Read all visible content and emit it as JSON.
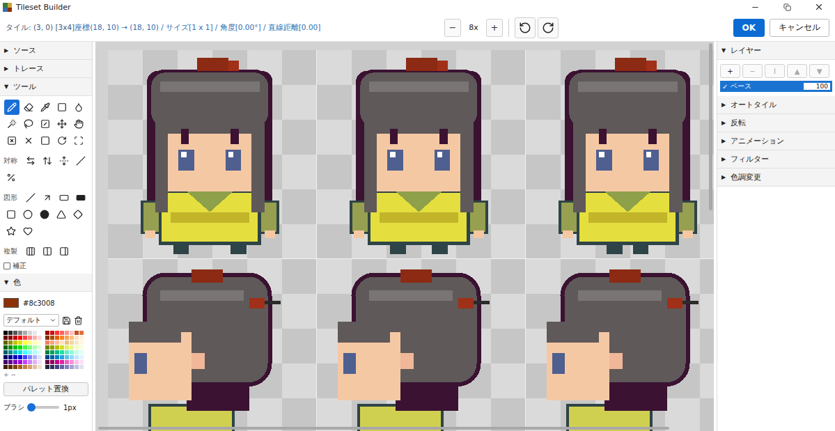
{
  "window": {
    "title": "Tileset Builder"
  },
  "status": {
    "tile": "タイル: (3, 0) [3x4]",
    "coords": "座標(18, 10) → (18, 10) / サイズ[1 x 1] / 角度[0.00°] / 直線距離[0.00]"
  },
  "zoom": {
    "decrease": "−",
    "value": "8x",
    "increase": "+"
  },
  "actions": [
    {
      "label": "OK",
      "primary": true
    },
    {
      "label": "キャンセル",
      "primary": false
    }
  ],
  "left_panel": {
    "collapsed_sections": [
      {
        "arrow": "▶",
        "label": "ソース",
        "expanded": false
      },
      {
        "arrow": "▶",
        "label": "トレース",
        "expanded": false
      }
    ],
    "tools_section": {
      "arrow": "▼",
      "label": "ツール",
      "expanded": true
    },
    "tools": [
      {
        "selected": true
      },
      {
        "selected": false
      },
      {
        "selected": false
      },
      {
        "selected": false
      },
      {
        "selected": false
      },
      {
        "selected": false
      },
      {
        "selected": false
      },
      {
        "selected": false
      },
      {
        "selected": false
      },
      {
        "selected": false
      },
      {
        "selected": false
      },
      {
        "selected": false
      },
      {
        "selected": false
      },
      {
        "selected": false
      },
      {
        "selected": false
      }
    ],
    "symmetry": {
      "label": "対称",
      "options": [
        {
          "selected": false
        },
        {
          "selected": false
        },
        {
          "selected": false
        },
        {
          "selected": false
        },
        {
          "selected": false
        }
      ]
    },
    "shapes": {
      "label": "図形",
      "options": [
        {
          "selected": false
        },
        {
          "selected": false
        },
        {
          "selected": false
        },
        {
          "selected": false
        },
        {
          "selected": false
        },
        {
          "selected": false
        },
        {
          "selected": false
        },
        {
          "selected": false
        },
        {
          "selected": false
        },
        {
          "selected": false
        },
        {
          "selected": false
        }
      ]
    },
    "duplicate": {
      "label": "複製",
      "options": [
        {
          "selected": false
        },
        {
          "selected": false
        },
        {
          "selected": false
        }
      ]
    },
    "correction": {
      "label": "補正",
      "checked": false
    },
    "color_section": {
      "arrow": "▼",
      "label": "色",
      "expanded": true
    },
    "current_color": {
      "hex": "#8c3008",
      "color": "#8c3008"
    },
    "palette_select": "デフォルト",
    "palette": [
      [
        "#000000",
        "#2b2b2b",
        "#555555",
        "#808080",
        "#aaaaaa",
        "#d4d4d4",
        "#e8e8e8",
        "#ffffff",
        "#a00000",
        "#d01010",
        "#ff3030",
        "#ff6060",
        "#ff9090",
        "#ffc0c0",
        "#c05020",
        "#e07040"
      ],
      [
        "#600000",
        "#900000",
        "#c00000",
        "#ff0000",
        "#ff4040",
        "#ff8080",
        "#ffb0b0",
        "#ffd8d8",
        "#803000",
        "#b04800",
        "#e06000",
        "#ff8020",
        "#ffa050",
        "#ffc080",
        "#ffe0c0",
        "#fff0e0"
      ],
      [
        "#606000",
        "#909000",
        "#c0c000",
        "#e0e000",
        "#ffff40",
        "#ffff80",
        "#ffffb0",
        "#ffffe0",
        "#f08060",
        "#f8a080",
        "#ffc0a0",
        "#ffe0c0",
        "#e8c080",
        "#f0d8a0",
        "#f8e8c0",
        "#fff8e0"
      ],
      [
        "#006000",
        "#009000",
        "#00c000",
        "#00e000",
        "#40ff40",
        "#80ff80",
        "#b0ffb0",
        "#e0ffe0",
        "#708000",
        "#90a000",
        "#b0c000",
        "#d0e020",
        "#e0f060",
        "#e8f890",
        "#f0ffc0",
        "#f8ffe0"
      ],
      [
        "#006060",
        "#009090",
        "#00c0c0",
        "#00e0e0",
        "#40ffff",
        "#80ffff",
        "#b0ffff",
        "#e0ffff",
        "#008040",
        "#00a060",
        "#00c080",
        "#20e0a0",
        "#60f0c0",
        "#90f8d8",
        "#c0ffe8",
        "#e0fff4"
      ],
      [
        "#000060",
        "#000090",
        "#0000c0",
        "#0000e0",
        "#4040ff",
        "#8080ff",
        "#b0b0ff",
        "#e0e0ff",
        "#004080",
        "#0060a0",
        "#0080c0",
        "#20a0e0",
        "#60c0f0",
        "#90d8f8",
        "#c0e8ff",
        "#e0f4ff"
      ],
      [
        "#400060",
        "#600090",
        "#8000c0",
        "#a000e0",
        "#c040ff",
        "#d080ff",
        "#e0b0ff",
        "#f0e0ff",
        "#600040",
        "#900060",
        "#c00080",
        "#e020a0",
        "#f060c0",
        "#f890d8",
        "#ffc0e8",
        "#ffe0f4"
      ],
      [
        "#402000",
        "#603000",
        "#804000",
        "#a06020",
        "#c08040",
        "#d0a070",
        "#e0c0a0",
        "#f0e0d0",
        "#202040",
        "#303060",
        "#404080",
        "#6060a0",
        "#8080c0",
        "#a0a0d0",
        "#c0c0e0",
        "#e0e0f0"
      ]
    ],
    "palette_controls": [
      "+",
      "−"
    ],
    "replace_button": "パレット置換",
    "brush": {
      "label": "ブラシ",
      "level": 0,
      "reading": "1px"
    }
  },
  "canvas": {
    "tiles": [
      {
        "kind": "front",
        "frame": 0
      },
      {
        "kind": "front",
        "frame": 1
      },
      {
        "kind": "front",
        "frame": 2
      },
      {
        "kind": "side",
        "frame": 0
      },
      {
        "kind": "side",
        "frame": 1
      },
      {
        "kind": "side",
        "frame": 2
      }
    ]
  },
  "right_panel": {
    "layers_section": {
      "arrow": "▼",
      "label": "レイヤー",
      "expanded": true
    },
    "layer_buttons": [
      {
        "label": "+",
        "disabled": false
      },
      {
        "label": "−",
        "disabled": true
      },
      {
        "label": "I",
        "disabled": true
      },
      {
        "label": "▲",
        "disabled": true
      },
      {
        "label": "▼",
        "disabled": true
      }
    ],
    "layers": [
      {
        "check": "✓",
        "name": "ベース",
        "opacity": "100",
        "visible": true,
        "selected": true
      }
    ],
    "sections": [
      {
        "arrow": "▶",
        "label": "オートタイル",
        "expanded": false
      },
      {
        "arrow": "▶",
        "label": "反転",
        "expanded": false
      },
      {
        "arrow": "▶",
        "label": "アニメーション",
        "expanded": false
      },
      {
        "arrow": "▶",
        "label": "フィルター",
        "expanded": false
      },
      {
        "arrow": "▶",
        "label": "色調変更",
        "expanded": false
      }
    ]
  }
}
